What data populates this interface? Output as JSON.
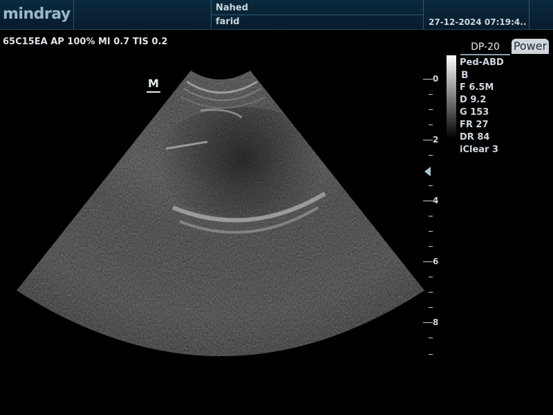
{
  "header": {
    "brand": "mindray",
    "patient_line1": "Nahed",
    "patient_line2": "farid",
    "datetime": "27-12-2024 07:19:4..."
  },
  "probe_info": "65C15EA  AP 100%  MI 0.7  TIS 0.2",
  "tabs": {
    "dp": "DP-20",
    "power": "Power"
  },
  "params": {
    "preset": "Ped-ABD",
    "mode": "B",
    "freq": "F 6.5M",
    "depth": "D 9.2",
    "gain": "G 153",
    "frame_rate": "FR 27",
    "dynamic_range": "DR 84",
    "iclear": "iClear 3"
  },
  "depth_scale": {
    "labels": [
      "0",
      "2",
      "4",
      "6",
      "8"
    ]
  },
  "orientation_marker": "M",
  "colors": {
    "header_bg": "#0b2a3f",
    "accent": "#9ab8cc",
    "focus": "#a9c4d6"
  }
}
